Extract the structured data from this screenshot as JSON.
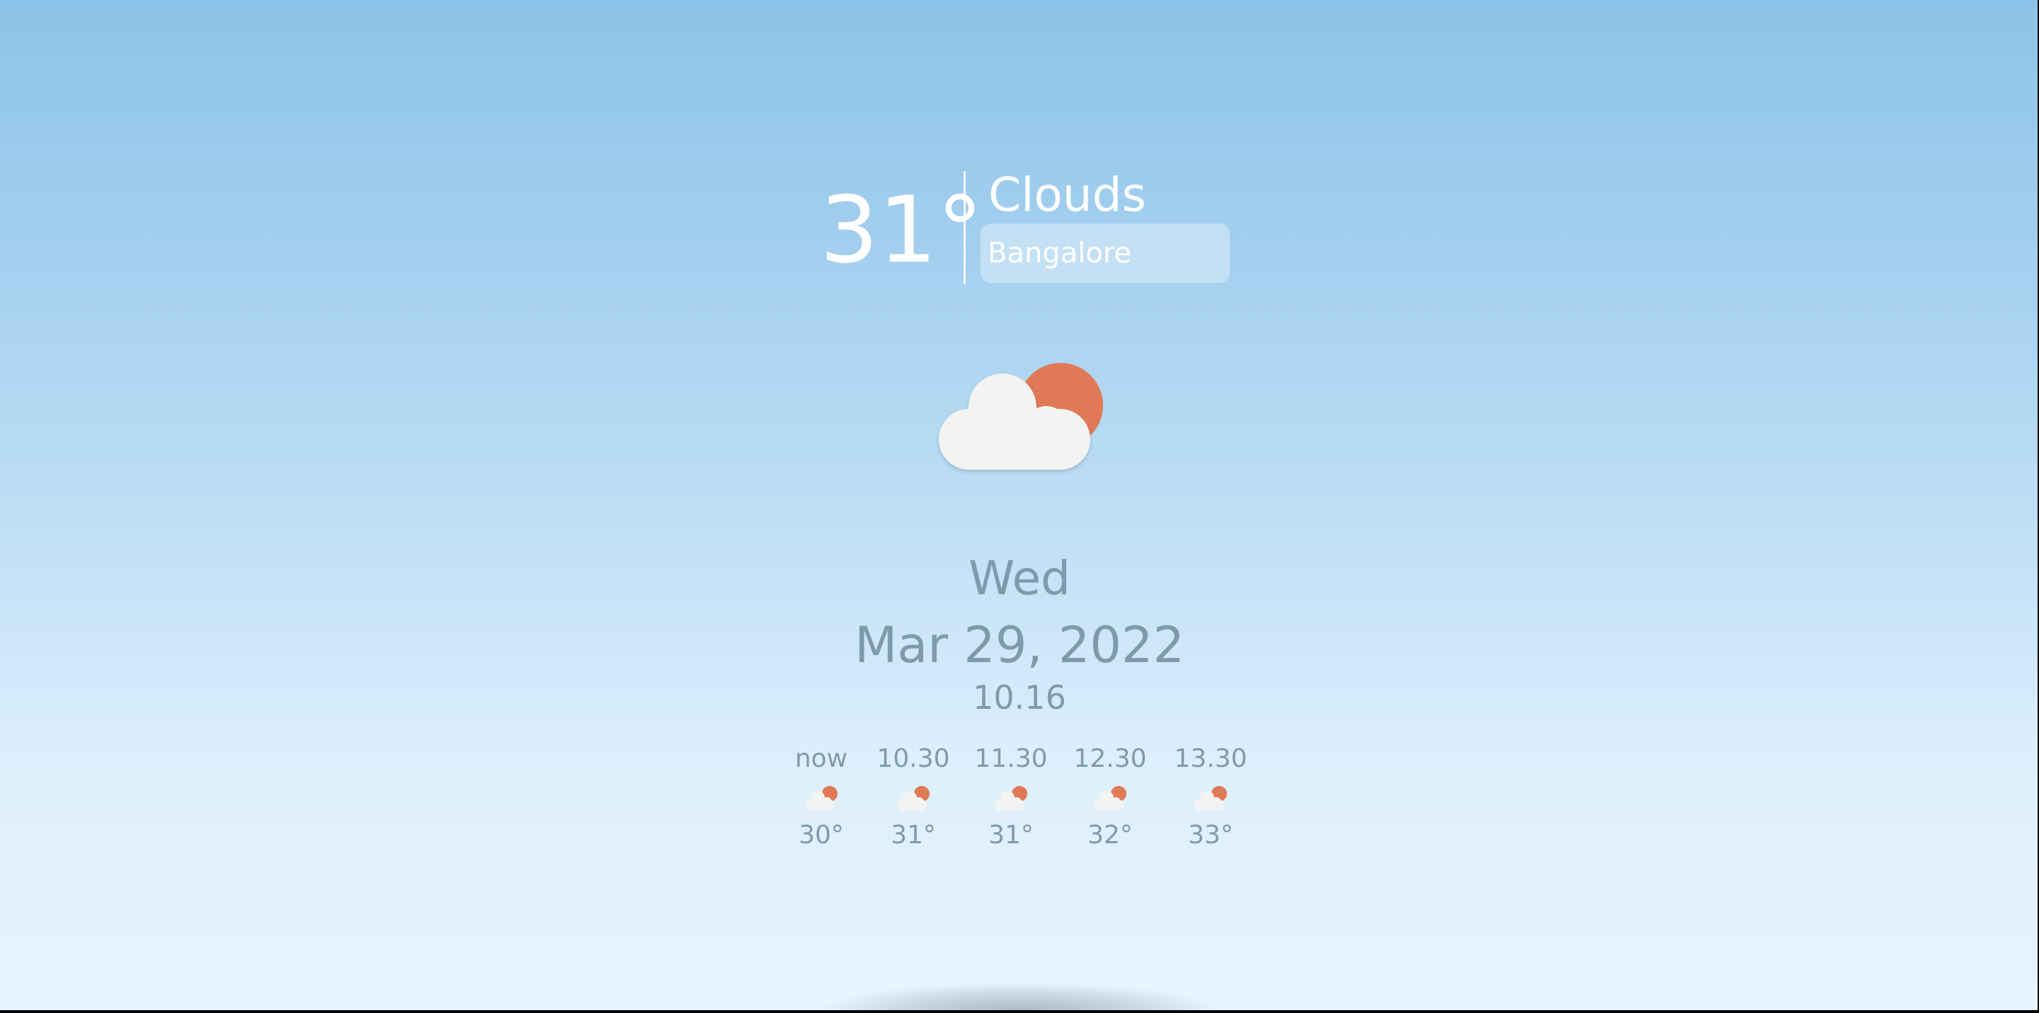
{
  "current": {
    "temperature": "31°",
    "condition": "Clouds",
    "city_value": "Bangalore",
    "city_placeholder": "Bangalore",
    "icon": "partly-cloudy-icon"
  },
  "date": {
    "day": "Wed",
    "full_date": "Mar 29, 2022",
    "time": "10.16"
  },
  "forecast": [
    {
      "time": "now",
      "icon": "partly-cloudy-icon",
      "temp": "30°"
    },
    {
      "time": "10.30",
      "icon": "partly-cloudy-icon",
      "temp": "31°"
    },
    {
      "time": "11.30",
      "icon": "partly-cloudy-icon",
      "temp": "31°"
    },
    {
      "time": "12.30",
      "icon": "partly-cloudy-icon",
      "temp": "32°"
    },
    {
      "time": "13.30",
      "icon": "partly-cloudy-icon",
      "temp": "33°"
    }
  ],
  "colors": {
    "sun": "#e07a56",
    "cloud": "#f3f3f1",
    "text_muted": "#7f9aac",
    "sky_top": "#8cc3e8",
    "sky_bottom": "#e6f4fd"
  }
}
